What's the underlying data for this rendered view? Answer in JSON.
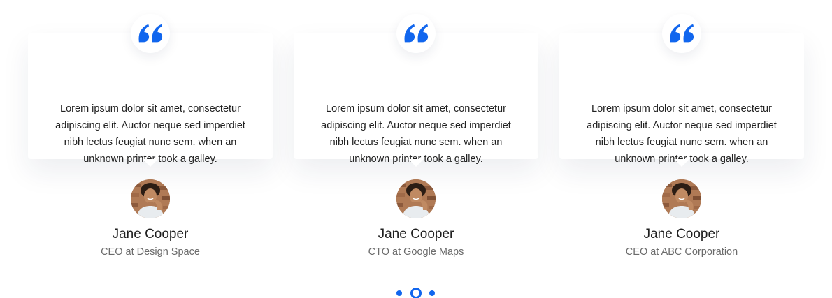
{
  "colors": {
    "accent": "#1166ee",
    "name_text": "#1f1f1f",
    "role_text": "#6b6b6b",
    "body_text": "#222222"
  },
  "testimonials": [
    {
      "quote": "Lorem ipsum dolor sit amet, consectetur adipiscing elit. Auctor neque sed imperdiet nibh lectus feugiat nunc sem. when an unknown printer took a galley.",
      "name": "Jane Cooper",
      "role": "CEO at Design Space",
      "quote_icon": "quote-icon",
      "avatar": "avatar-photo"
    },
    {
      "quote": "Lorem ipsum dolor sit amet, consectetur adipiscing elit. Auctor neque sed imperdiet nibh lectus feugiat nunc sem. when an unknown printer took a galley.",
      "name": "Jane Cooper",
      "role": "CTO at Google Maps",
      "quote_icon": "quote-icon",
      "avatar": "avatar-photo"
    },
    {
      "quote": "Lorem ipsum dolor sit amet, consectetur adipiscing elit. Auctor neque sed imperdiet nibh lectus feugiat nunc sem. when an unknown printer took a galley.",
      "name": "Jane Cooper",
      "role": "CEO at ABC Corporation",
      "quote_icon": "quote-icon",
      "avatar": "avatar-photo"
    }
  ],
  "pagination": {
    "count": 3,
    "active_index": 1
  }
}
